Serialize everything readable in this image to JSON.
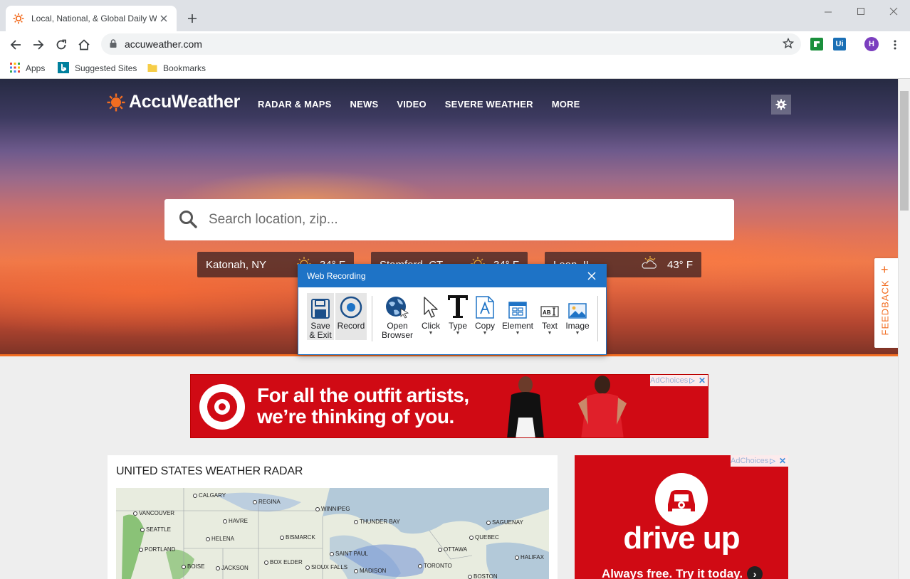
{
  "browser": {
    "tab_title": "Local, National, & Global Daily W",
    "url": "accuweather.com",
    "profile_initial": "H",
    "ext_ui_label": "Ui",
    "bookmarks": [
      {
        "label": "Apps",
        "icon": "apps-grid-icon"
      },
      {
        "label": "Suggested Sites",
        "icon": "bing-icon"
      },
      {
        "label": "Bookmarks",
        "icon": "folder-icon"
      }
    ]
  },
  "site": {
    "brand": "AccuWeather",
    "nav": [
      "RADAR & MAPS",
      "NEWS",
      "VIDEO",
      "SEVERE WEATHER",
      "MORE"
    ],
    "search_placeholder": "Search location, zip...",
    "locations": [
      {
        "city": "Katonah, NY",
        "temp": "34° F",
        "icon": "sun-icon"
      },
      {
        "city": "Stamford, CT",
        "temp": "34° F",
        "icon": "sun-icon"
      },
      {
        "city": "Leon, IL",
        "temp": "43° F",
        "icon": "partly-cloudy-icon"
      }
    ],
    "feedback": "FEEDBACK",
    "ad_banner": {
      "line1": "For all the outfit artists,",
      "line2": "we’re thinking of you.",
      "adchoices": "AdChoices"
    },
    "radar": {
      "title": "UNITED STATES WEATHER RADAR",
      "cities": [
        "CALGARY",
        "REGINA",
        "WINNIPEG",
        "VANCOUVER",
        "HAVRE",
        "THUNDER BAY",
        "SAGUENAY",
        "SEATTLE",
        "HELENA",
        "BISMARCK",
        "QUEBEC",
        "PORTLAND",
        "SAINT PAUL",
        "OTTAWA",
        "BOISE",
        "JACKSON",
        "BOX ELDER",
        "SIOUX FALLS",
        "MADISON",
        "TORONTO",
        "HALIFAX",
        "BOSTON"
      ]
    },
    "ad_side": {
      "headline": "drive up",
      "tagline": "Always free. Try it today.",
      "adchoices": "AdChoices"
    }
  },
  "web_recording": {
    "title": "Web Recording",
    "buttons": [
      {
        "line1": "Save",
        "line2": "& Exit",
        "icon": "save-icon"
      },
      {
        "line1": "Record",
        "line2": "",
        "icon": "record-icon"
      },
      {
        "line1": "Open",
        "line2": "Browser",
        "icon": "globe-cursor-icon"
      },
      {
        "line1": "Click",
        "line2": "",
        "icon": "cursor-icon"
      },
      {
        "line1": "Type",
        "line2": "",
        "icon": "type-icon"
      },
      {
        "line1": "Copy",
        "line2": "",
        "icon": "copy-icon"
      },
      {
        "line1": "Element",
        "line2": "",
        "icon": "element-icon"
      },
      {
        "line1": "Text",
        "line2": "",
        "icon": "text-icon"
      },
      {
        "line1": "Image",
        "line2": "",
        "icon": "image-icon"
      }
    ]
  },
  "colors": {
    "accent": "#f26d21",
    "dialog_blue": "#1e73c6",
    "ad_red": "#d00a14"
  }
}
